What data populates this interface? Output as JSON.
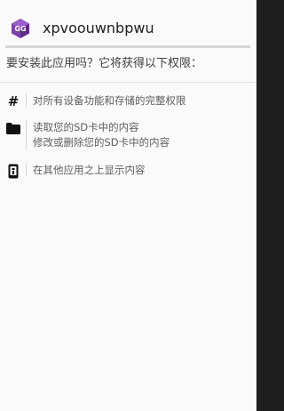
{
  "app": {
    "name": "xpvoouwnbpwu",
    "icon": "game-guardian-logo",
    "icon_letters": "GG"
  },
  "prompt": {
    "question": "要安装此应用吗？它将获得以下权限："
  },
  "permissions": [
    {
      "icon": "hash-icon",
      "lines": [
        "对所有设备功能和存储的完整权限"
      ]
    },
    {
      "icon": "folder-icon",
      "lines": [
        "读取您的SD卡中的内容",
        "修改或删除您的SD卡中的内容"
      ]
    },
    {
      "icon": "phone-overlay-icon",
      "lines": [
        "在其他应用之上显示内容"
      ]
    }
  ],
  "colors": {
    "background": "#fafafa",
    "logo_purple": "#7b3fb0",
    "icon_dark": "#111111"
  }
}
